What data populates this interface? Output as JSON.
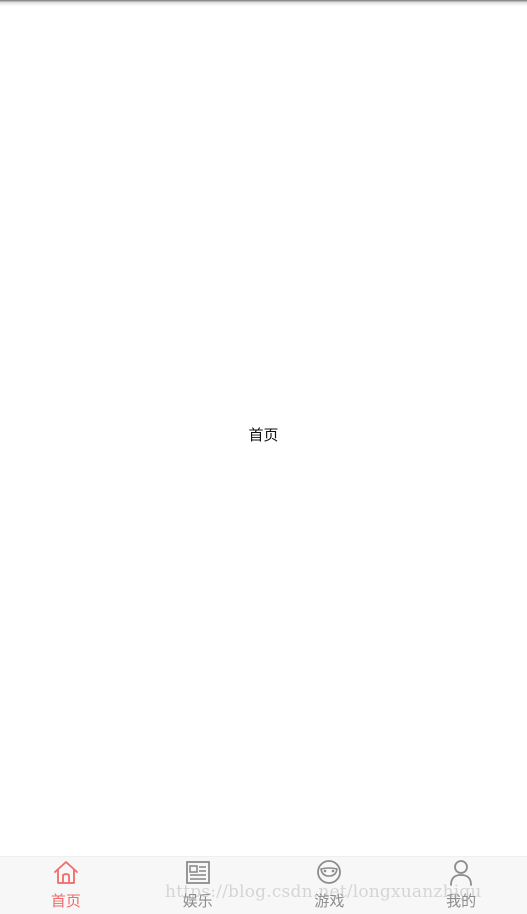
{
  "page": {
    "center_label": "首页"
  },
  "tabbar": {
    "active_color": "#f06a6a",
    "inactive_color": "#8c8c8c",
    "tabs": [
      {
        "label": "首页",
        "icon": "home-icon",
        "active": true
      },
      {
        "label": "娱乐",
        "icon": "news-icon",
        "active": false
      },
      {
        "label": "游戏",
        "icon": "game-icon",
        "active": false
      },
      {
        "label": "我的",
        "icon": "user-icon",
        "active": false
      }
    ]
  },
  "watermark": {
    "text": "https://blog.csdn.net/longxuanzhigu"
  }
}
